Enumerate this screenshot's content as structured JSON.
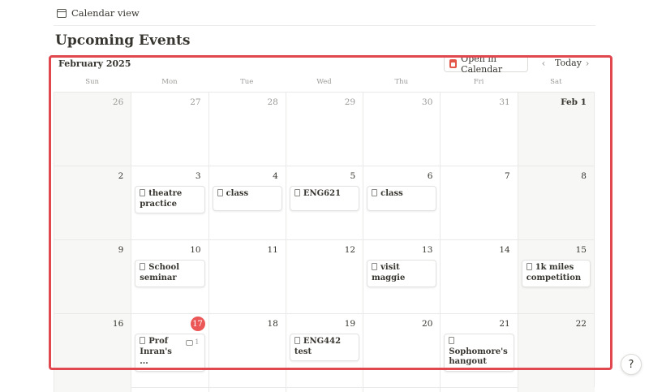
{
  "view": {
    "tab_label": "Calendar view",
    "icon": "calendar-icon"
  },
  "page": {
    "title": "Upcoming Events"
  },
  "calendar": {
    "month": "February 2025",
    "open_button": "Open in Calendar",
    "today_button": "Today",
    "prev": "‹",
    "next": "›",
    "weekdays": [
      "Sun",
      "Mon",
      "Tue",
      "Wed",
      "Thu",
      "Fri",
      "Sat"
    ],
    "weeks": [
      [
        {
          "day": "26",
          "muted": true
        },
        {
          "day": "27",
          "muted": true
        },
        {
          "day": "28",
          "muted": true
        },
        {
          "day": "29",
          "muted": true
        },
        {
          "day": "30",
          "muted": true
        },
        {
          "day": "31",
          "muted": true
        },
        {
          "day": "Feb 1",
          "bold": true
        }
      ],
      [
        {
          "day": "2"
        },
        {
          "day": "3",
          "event": "theatre practice"
        },
        {
          "day": "4",
          "event": "class"
        },
        {
          "day": "5",
          "event": "ENG621"
        },
        {
          "day": "6",
          "event": "class"
        },
        {
          "day": "7"
        },
        {
          "day": "8"
        }
      ],
      [
        {
          "day": "9"
        },
        {
          "day": "10",
          "event": "School seminar"
        },
        {
          "day": "11"
        },
        {
          "day": "12"
        },
        {
          "day": "13",
          "event": "visit maggie"
        },
        {
          "day": "14"
        },
        {
          "day": "15",
          "event": "1k miles competition"
        }
      ],
      [
        {
          "day": "16"
        },
        {
          "day": "17",
          "today": true,
          "event": "Prof Inran's ...",
          "comments": "1"
        },
        {
          "day": "18"
        },
        {
          "day": "19",
          "event": "ENG442 test"
        },
        {
          "day": "20"
        },
        {
          "day": "21",
          "event": "Sophomore's hangout"
        },
        {
          "day": "22"
        }
      ]
    ]
  },
  "help": {
    "icon": "help-icon",
    "glyph": "?"
  },
  "colors": {
    "today": "#eb5757",
    "highlight": "#e0474f",
    "weekend_bg": "#f7f7f5"
  }
}
